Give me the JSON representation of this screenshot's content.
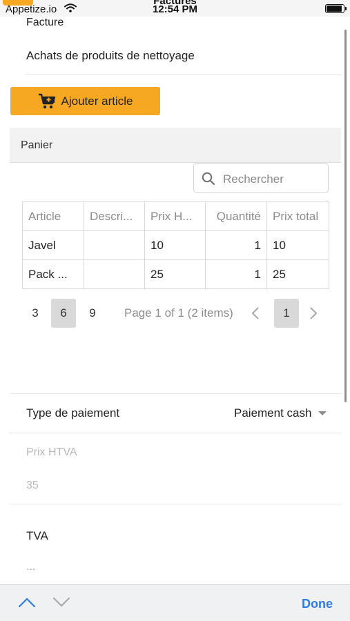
{
  "status_bar": {
    "carrier": "Appetize.io",
    "nav_title": "Factures",
    "time": "12:54 PM",
    "battery_level": 0.95
  },
  "form": {
    "facture_label": "Facture",
    "facture_value": "Achats de produits de nettoyage",
    "add_button_label": "Ajouter article",
    "accent_color": "#f7a823"
  },
  "panier": {
    "title": "Panier",
    "search_placeholder": "Rechercher",
    "columns": [
      "Article",
      "Descri...",
      "Prix H...",
      "Quantité",
      "Prix total"
    ],
    "rows": [
      [
        "Javel",
        "",
        "10",
        "1",
        "10"
      ],
      [
        "Pack ...",
        "",
        "25",
        "1",
        "25"
      ]
    ],
    "page_sizes": [
      "3",
      "6",
      "9"
    ],
    "selected_page_size": "6",
    "page_info": "Page 1 of 1 (2 items)",
    "current_page": "1"
  },
  "payment": {
    "type_label": "Type de paiement",
    "type_value": "Paiement cash",
    "htva_label": "Prix HTVA",
    "htva_value": "35",
    "tva_label": "TVA",
    "tva_value": "..."
  },
  "keyboard_toolbar": {
    "done_label": "Done",
    "done_color": "#2f7de1"
  }
}
